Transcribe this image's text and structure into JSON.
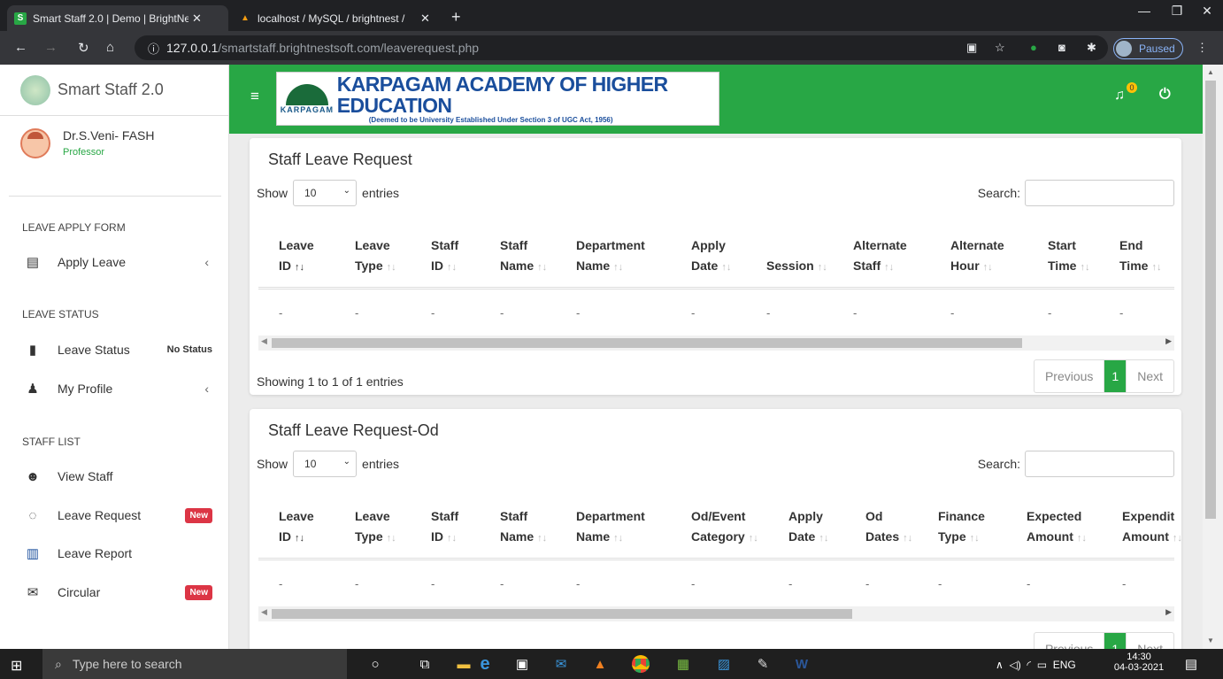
{
  "browser": {
    "tabs": [
      {
        "title": "Smart Staff 2.0 | Demo | BrightNe",
        "favicon": "S",
        "active": true
      },
      {
        "title": "localhost / MySQL / brightnest / ",
        "favicon": "phpmyadmin-icon",
        "active": false
      }
    ],
    "url_host": "127.0.0.1",
    "url_path": "/smartstaff.brightnestsoft.com/leaverequest.php",
    "paused_label": "Paused"
  },
  "sidebar": {
    "brand": "Smart Staff 2.0",
    "user_name": "Dr.S.Veni- FASH",
    "user_role": "Professor",
    "sections": {
      "leave_apply": "LEAVE APPLY FORM",
      "leave_status": "LEAVE STATUS",
      "staff_list": "STAFF LIST"
    },
    "items": {
      "apply_leave": "Apply Leave",
      "leave_status": "Leave Status",
      "leave_status_badge": "No Status",
      "my_profile": "My Profile",
      "view_staff": "View Staff",
      "leave_request": "Leave Request",
      "leave_request_badge": "New",
      "leave_report": "Leave Report",
      "circular": "Circular",
      "circular_badge": "New"
    }
  },
  "header": {
    "logo_small": "KARPAGAM",
    "institution": "KARPAGAM ACADEMY OF HIGHER EDUCATION",
    "institution_sub": "(Deemed to be University Established Under Section 3 of UGC Act, 1956)",
    "bell_count": "0",
    "brand_color": "#28a745"
  },
  "table1": {
    "title": "Staff Leave Request",
    "show": "Show",
    "entries_value": "10",
    "entries": "entries",
    "search": "Search:",
    "headers": [
      [
        "Leave",
        "ID"
      ],
      [
        "Leave",
        "Type"
      ],
      [
        "Staff",
        "ID"
      ],
      [
        "Staff",
        "Name"
      ],
      [
        "Department",
        "Name"
      ],
      [
        "Apply",
        "Date"
      ],
      [
        "",
        "Session"
      ],
      [
        "Alternate",
        "Staff"
      ],
      [
        "Alternate",
        "Hour"
      ],
      [
        "Start",
        "Time"
      ],
      [
        "End",
        "Time"
      ]
    ],
    "row": [
      "-",
      "-",
      "-",
      "-",
      "-",
      "-",
      "-",
      "-",
      "-",
      "-",
      "-"
    ],
    "info": "Showing 1 to 1 of 1 entries",
    "prev": "Previous",
    "page": "1",
    "next": "Next"
  },
  "table2": {
    "title": "Staff Leave Request-Od",
    "show": "Show",
    "entries_value": "10",
    "entries": "entries",
    "search": "Search:",
    "headers": [
      [
        "Leave",
        "ID"
      ],
      [
        "Leave",
        "Type"
      ],
      [
        "Staff",
        "ID"
      ],
      [
        "Staff",
        "Name"
      ],
      [
        "Department",
        "Name"
      ],
      [
        "Od/Event",
        "Category"
      ],
      [
        "Apply",
        "Date"
      ],
      [
        "Od",
        "Dates"
      ],
      [
        "Finance",
        "Type"
      ],
      [
        "Expected",
        "Amount"
      ],
      [
        "Expendit",
        "Amount"
      ]
    ],
    "row": [
      "-",
      "-",
      "-",
      "-",
      "-",
      "-",
      "-",
      "-",
      "-",
      "-",
      "-"
    ],
    "prev": "Previous",
    "page": "1",
    "next": "Next"
  },
  "taskbar": {
    "search_placeholder": "Type here to search",
    "lang": "ENG",
    "time": "14:30",
    "date": "04-03-2021"
  }
}
